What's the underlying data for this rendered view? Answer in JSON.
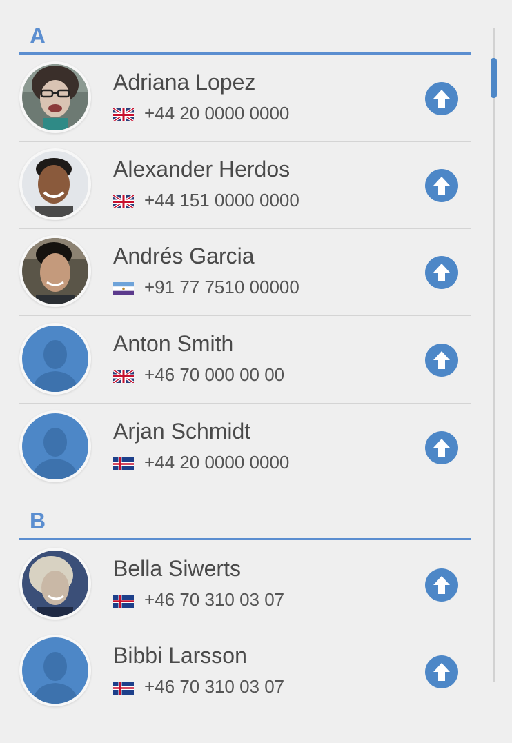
{
  "sections": [
    {
      "letter": "A",
      "contacts": [
        {
          "name": "Adriana Lopez",
          "phone": "+44 20 0000 0000",
          "flag": "uk-flag-icon",
          "avatar": "photo-woman-glasses"
        },
        {
          "name": "Alexander Herdos",
          "phone": "+44 151 0000 0000",
          "flag": "uk-flag-icon",
          "avatar": "photo-man-smiling"
        },
        {
          "name": "Andrés Garcia",
          "phone": "+91 77 7510 00000",
          "flag": "blue-white-purple-flag-icon",
          "avatar": "photo-man-dark-hair"
        },
        {
          "name": "Anton Smith",
          "phone": "+46 70 000 00 00",
          "flag": "uk-flag-icon",
          "avatar": "default-silhouette"
        },
        {
          "name": "Arjan Schmidt",
          "phone": "+44 20 0000 0000",
          "flag": "nordic-flag-icon",
          "avatar": "default-silhouette"
        }
      ]
    },
    {
      "letter": "B",
      "contacts": [
        {
          "name": "Bella Siwerts",
          "phone": "+46 70 310 03 07",
          "flag": "nordic-flag-icon",
          "avatar": "photo-woman-blonde"
        },
        {
          "name": "Bibbi Larsson",
          "phone": "+46 70 310 03 07",
          "flag": "nordic-flag-icon",
          "avatar": "default-silhouette"
        }
      ]
    }
  ],
  "action_icon": "arrow-up-circle-icon",
  "colors": {
    "accent": "#4d87c7",
    "header_text": "#5b8ed0",
    "background": "#efefef",
    "name_text": "#4a4a4a",
    "divider": "#d4d4d4"
  }
}
